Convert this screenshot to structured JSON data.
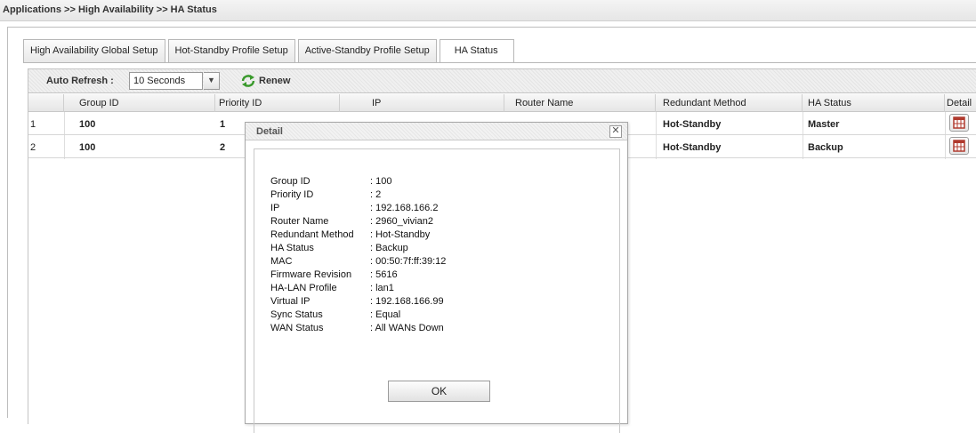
{
  "breadcrumb": "Applications >> High Availability >> HA Status",
  "tabs": [
    {
      "label": "High Availability Global Setup"
    },
    {
      "label": "Hot-Standby Profile Setup"
    },
    {
      "label": "Active-Standby Profile Setup"
    },
    {
      "label": "HA Status"
    }
  ],
  "active_tab": "HA Status",
  "toolbar": {
    "auto_refresh_label": "Auto Refresh :",
    "auto_refresh_value": "10 Seconds",
    "renew_label": "Renew"
  },
  "table": {
    "columns": [
      "Group ID",
      "Priority ID",
      "IP",
      "Router Name",
      "Redundant Method",
      "HA Status",
      "Detail"
    ],
    "rows": [
      {
        "index": "1",
        "group_id": "100",
        "priority_id": "1",
        "redundant_method": "Hot-Standby",
        "ha_status": "Master"
      },
      {
        "index": "2",
        "group_id": "100",
        "priority_id": "2",
        "redundant_method": "Hot-Standby",
        "ha_status": "Backup"
      }
    ]
  },
  "dialog": {
    "title": "Detail",
    "close_glyph": "✕",
    "fields": [
      {
        "label": "Group ID",
        "value": ": 100"
      },
      {
        "label": "Priority ID",
        "value": ": 2"
      },
      {
        "label": "IP",
        "value": ": 192.168.166.2"
      },
      {
        "label": "Router Name",
        "value": ": 2960_vivian2"
      },
      {
        "label": "Redundant Method",
        "value": ": Hot-Standby"
      },
      {
        "label": "HA Status",
        "value": ": Backup"
      },
      {
        "label": "MAC",
        "value": ": 00:50:7f:ff:39:12"
      },
      {
        "label": "Firmware Revision",
        "value": ": 5616"
      },
      {
        "label": "HA-LAN Profile",
        "value": ": lan1"
      },
      {
        "label": "Virtual IP",
        "value": ": 192.168.166.99"
      },
      {
        "label": "Sync Status",
        "value": ": Equal"
      },
      {
        "label": "WAN Status",
        "value": ": All WANs Down"
      }
    ],
    "ok_label": "OK"
  },
  "colors": {
    "renew_icon": "#3a9a2c",
    "detail_icon": "#b03a2e"
  },
  "icons": {
    "renew": "refresh-arrows-icon",
    "detail": "table-grid-icon",
    "dropdown": "chevron-down-icon",
    "close": "close-icon"
  }
}
